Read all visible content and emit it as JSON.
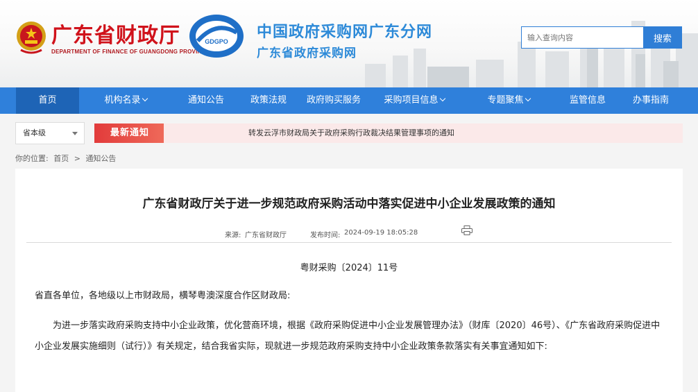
{
  "header": {
    "dept_name_cn": "广东省财政厅",
    "dept_name_en": "DEPARTMENT OF FINANCE OF GUANGDONG PROVINCE",
    "logo_text": "GDGPO",
    "site_title_1": "中国政府采购网广东分网",
    "site_title_2": "广东省政府采购网",
    "search_placeholder": "输入查询内容",
    "search_button": "搜索",
    "brand_color": "#2f80db",
    "accent_red": "#d0121b"
  },
  "nav": {
    "items": [
      {
        "label": "首页",
        "active": true
      },
      {
        "label": "机构名录",
        "dropdown": true
      },
      {
        "label": "通知公告"
      },
      {
        "label": "政策法规"
      },
      {
        "label": "政府购买服务"
      },
      {
        "label": "采购项目信息",
        "dropdown": true
      },
      {
        "label": "专题聚焦",
        "dropdown": true
      },
      {
        "label": "监管信息"
      },
      {
        "label": "办事指南"
      }
    ]
  },
  "notice_bar": {
    "region": "省本级",
    "badge": "最新通知",
    "text": "转发云浮市财政局关于政府采购行政裁决结果管理事项的通知"
  },
  "breadcrumb": {
    "label": "你的位置:",
    "home": "首页",
    "sep": ">",
    "current": "通知公告"
  },
  "article": {
    "title": "广东省财政厅关于进一步规范政府采购活动中落实促进中小企业发展政策的通知",
    "source_label": "来源:",
    "source": "广东省财政厅",
    "time_label": "发布时间:",
    "time": "2024-09-19 18:05:28",
    "doc_number": "粤财采购〔2024〕11号",
    "salutation": "省直各单位，各地级以上市财政局，横琴粤澳深度合作区财政局:",
    "body_1": "为进一步落实政府采购支持中小企业政策，优化营商环境，根据《政府采购促进中小企业发展管理办法》（财库〔2020〕46号）、《广东省政府采购促进中小企业发展实施细则（试行）》有关规定，结合我省实际，现就进一步规范政府采购支持中小企业政策条款落实有关事宜通知如下:"
  }
}
